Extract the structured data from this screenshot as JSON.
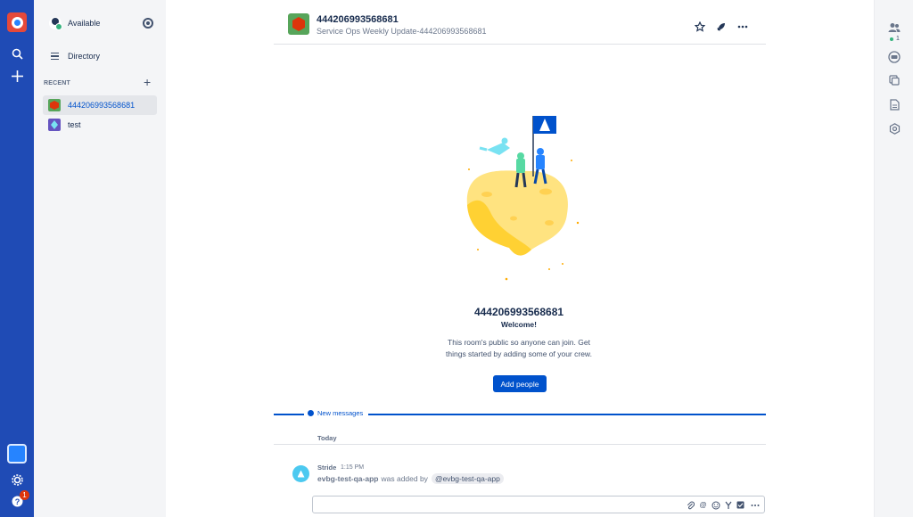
{
  "nav": {
    "logo_icon": "stride-logo-icon",
    "search_icon": "search-icon",
    "create_icon": "plus-icon",
    "app_icon": "bot-app-icon",
    "settings_icon": "gear-icon",
    "help_icon": "help-icon",
    "help_badge": "1"
  },
  "sidebar": {
    "status_label": "Available",
    "directory_label": "Directory",
    "recent_header": "RECENT",
    "rooms": [
      {
        "label": "444206993568681",
        "active": true,
        "color": "#57a55a"
      },
      {
        "label": "test",
        "active": false,
        "color": "#6554c0"
      }
    ]
  },
  "header": {
    "title": "444206993568681",
    "subtitle": "Service Ops Weekly Update-444206993568681"
  },
  "welcome": {
    "title": "444206993568681",
    "subtitle": "Welcome!",
    "desc_line1": "This room's public so anyone can join. Get",
    "desc_line2": "things started by adding some of your crew.",
    "button": "Add people"
  },
  "divider": {
    "new_messages": "New messages",
    "today": "Today"
  },
  "message": {
    "author": "Stride",
    "time": "1:15 PM",
    "app_name": "evbg-test-qa-app",
    "text": "was added by",
    "mention": "@evbg-test-qa-app"
  },
  "composer": {
    "value": ""
  },
  "right": {
    "people_count": "1"
  },
  "colors": {
    "nav_bg": "#1f4bb5",
    "accent": "#0052cc",
    "sidebar_bg": "#f4f5f7"
  }
}
